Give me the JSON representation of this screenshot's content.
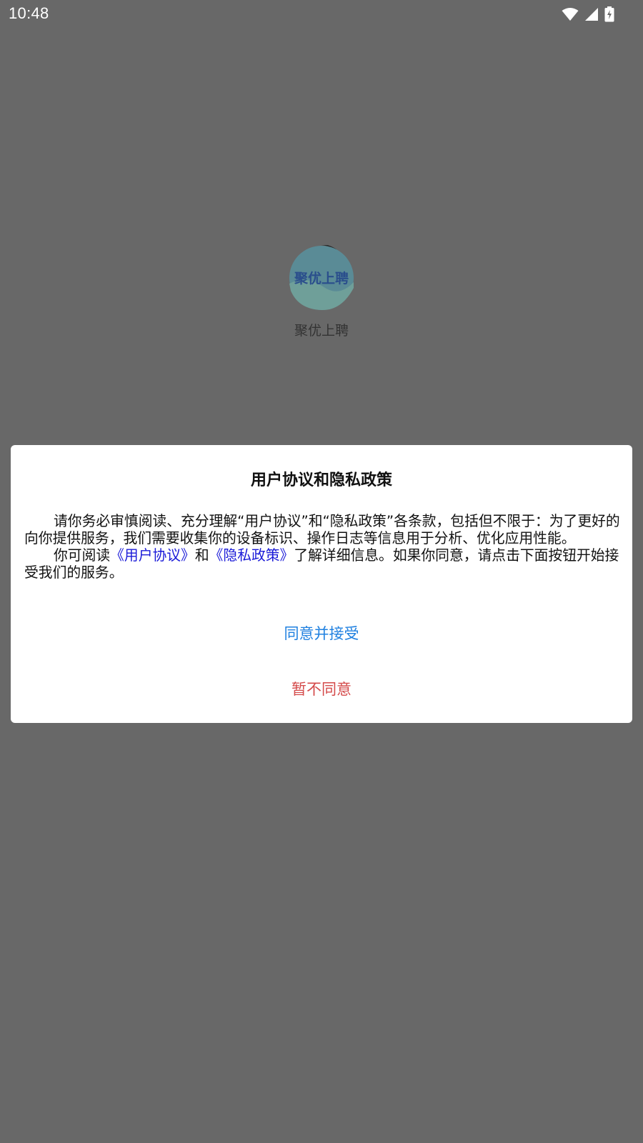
{
  "status_bar": {
    "time": "10:48",
    "icons": [
      "wifi-icon",
      "cell-signal-icon",
      "battery-charging-icon"
    ]
  },
  "splash": {
    "logo_text": "聚优上聘",
    "app_name": "聚优上聘"
  },
  "dialog": {
    "title": "用户协议和隐私政策",
    "paragraph1": "请你务必审慎阅读、充分理解“用户协议”和“隐私政策”各条款，包括但不限于：为了更好的向你提供服务，我们需要收集你的设备标识、操作日志等信息用于分析、优化应用性能。",
    "paragraph2": {
      "prefix": "你可阅读",
      "link_user_agreement": "《用户协议》",
      "connector": "和",
      "link_privacy_policy": "《隐私政策》",
      "suffix": "了解详细信息。如果你同意，请点击下面按钮开始接受我们的服务。"
    },
    "accept_label": "同意并接受",
    "decline_label": "暂不同意"
  },
  "colors": {
    "overlay_background": "#686868",
    "link": "#1a1ad8",
    "accept": "#1f80e0",
    "decline": "#d44a4a"
  }
}
